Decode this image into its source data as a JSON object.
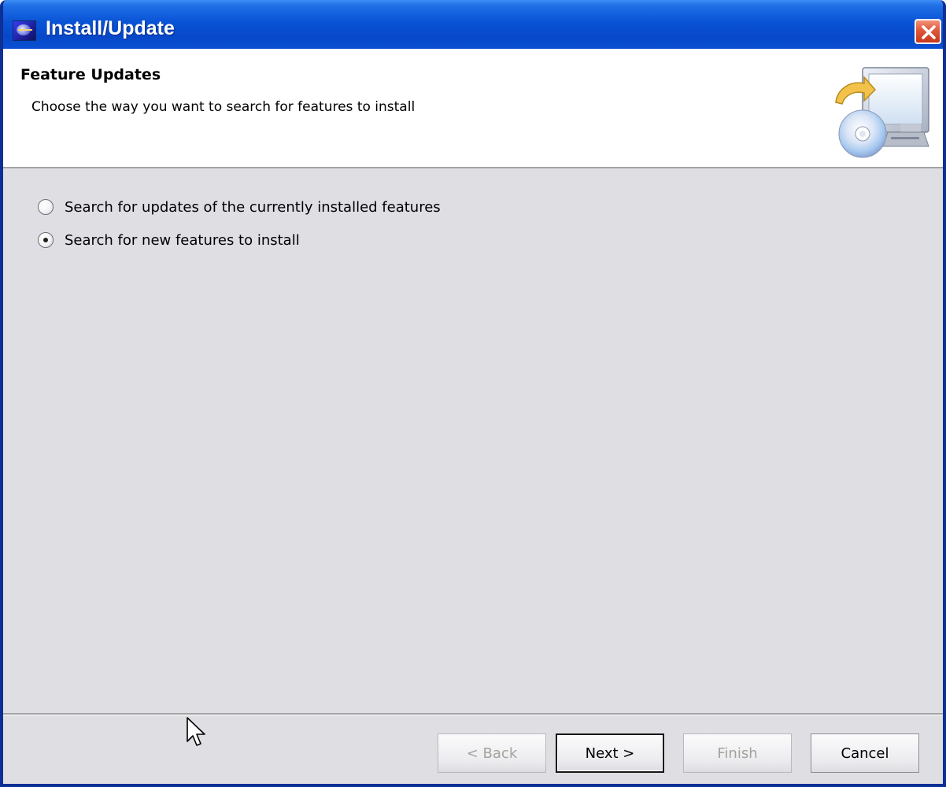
{
  "window": {
    "title": "Install/Update"
  },
  "header": {
    "title": "Feature Updates",
    "subtitle": "Choose the way you want to search for features to install",
    "graphic_icon": "install-wizard-computer-cd-icon"
  },
  "options": [
    {
      "label": "Search for updates of the currently installed features",
      "selected": false
    },
    {
      "label": "Search for new features to install",
      "selected": true
    }
  ],
  "buttons": {
    "back": "< Back",
    "next": "Next >",
    "finish": "Finish",
    "cancel": "Cancel"
  },
  "colors": {
    "titlebar": "#0a53d6",
    "dialog_background": "#dfdee3",
    "close_button": "#e0583a"
  }
}
